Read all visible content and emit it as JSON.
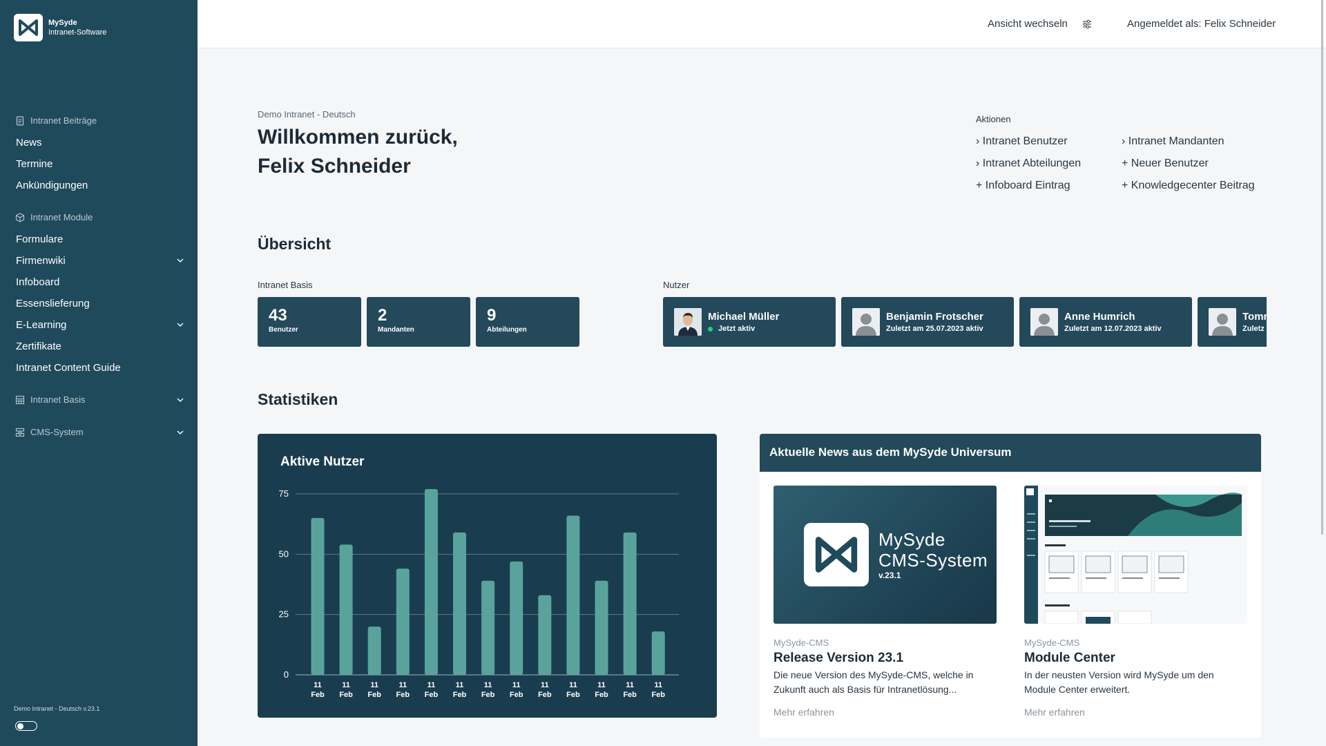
{
  "app": {
    "name": "MySyde",
    "subtitle": "Intranet-Software",
    "footer": "Demo Intranet - Deutsch  v.23.1"
  },
  "sidebar": {
    "groups": [
      {
        "label": "Intranet Beiträge",
        "icon": "document-icon",
        "items": [
          {
            "label": "News"
          },
          {
            "label": "Termine"
          },
          {
            "label": "Ankündigungen"
          }
        ]
      },
      {
        "label": "Intranet Module",
        "icon": "cube-icon",
        "items": [
          {
            "label": "Formulare"
          },
          {
            "label": "Firmenwiki",
            "expandable": true
          },
          {
            "label": "Infoboard"
          },
          {
            "label": "Essenslieferung"
          },
          {
            "label": "E-Learning",
            "expandable": true
          },
          {
            "label": "Zertifikate"
          },
          {
            "label": "Intranet Content Guide"
          }
        ]
      },
      {
        "label": "Intranet Basis",
        "icon": "grid-icon",
        "expandable": true
      },
      {
        "label": "CMS-System",
        "icon": "sitemap-icon",
        "expandable": true
      }
    ]
  },
  "topbar": {
    "switch_view": "Ansicht wechseln",
    "switch_icon": "sliders-icon",
    "logged_in": "Angemeldet als: Felix Schneider"
  },
  "header": {
    "breadcrumb": "Demo Intranet - Deutsch",
    "welcome_line1": "Willkommen zurück,",
    "welcome_line2": "Felix Schneider"
  },
  "actions": {
    "title": "Aktionen",
    "items": [
      {
        "prefix": "›",
        "label": "Intranet Benutzer"
      },
      {
        "prefix": "›",
        "label": "Intranet Mandanten"
      },
      {
        "prefix": "›",
        "label": "Intranet Abteilungen"
      },
      {
        "prefix": "+",
        "label": "Neuer Benutzer"
      },
      {
        "prefix": "+",
        "label": "Infoboard Eintrag"
      },
      {
        "prefix": "+",
        "label": "Knowledgecenter Beitrag"
      }
    ]
  },
  "overview": {
    "title": "Übersicht",
    "basis_label": "Intranet Basis",
    "stats": [
      {
        "value": "43",
        "label": "Benutzer"
      },
      {
        "value": "2",
        "label": "Mandanten"
      },
      {
        "value": "9",
        "label": "Abteilungen"
      }
    ],
    "users_label": "Nutzer",
    "users": [
      {
        "name": "Michael Müller",
        "status": "Jetzt aktiv",
        "online": true,
        "photo": true
      },
      {
        "name": "Benjamin Frotscher",
        "status": "Zuletzt am 25.07.2023 aktiv",
        "online": false,
        "photo": false
      },
      {
        "name": "Anne Humrich",
        "status": "Zuletzt am 12.07.2023 aktiv",
        "online": false,
        "photo": false
      },
      {
        "name": "Tomm",
        "status": "Zuletz",
        "online": false,
        "photo": false
      }
    ]
  },
  "stats_section": {
    "title": "Statistiken"
  },
  "chart_data": {
    "type": "bar",
    "title": "Aktive Nutzer",
    "categories": [
      "11 Feb",
      "11 Feb",
      "11 Feb",
      "11 Feb",
      "11 Feb",
      "11 Feb",
      "11 Feb",
      "11 Feb",
      "11 Feb",
      "11 Feb",
      "11 Feb",
      "11 Feb",
      "11 Feb"
    ],
    "values": [
      65,
      54,
      20,
      44,
      77,
      59,
      39,
      47,
      33,
      66,
      39,
      59,
      18
    ],
    "yticks": [
      0,
      25,
      50,
      75
    ],
    "ylim": [
      0,
      75
    ],
    "grid": true,
    "bar_color": "#5aa39d"
  },
  "news": {
    "title": "Aktuelle News aus dem MySyde Universum",
    "items": [
      {
        "category": "MySyde-CMS",
        "title": "Release Version 23.1",
        "description": "Die neue Version des MySyde-CMS, welche in Zukunft auch als Basis für Intranetlösung...",
        "more": "Mehr erfahren",
        "image_line1": "MySyde",
        "image_line2": "CMS-System",
        "image_version": "v.23.1"
      },
      {
        "category": "MySyde-CMS",
        "title": "Module Center",
        "description": "In der neusten Version wird MySyde um den Module Center erweitert.",
        "more": "Mehr erfahren"
      }
    ]
  },
  "colors": {
    "sidebar": "#1f4a5c",
    "card": "#23495b",
    "chart_bg": "#193d4e",
    "accent": "#5aa39d",
    "online": "#2ecc71"
  }
}
